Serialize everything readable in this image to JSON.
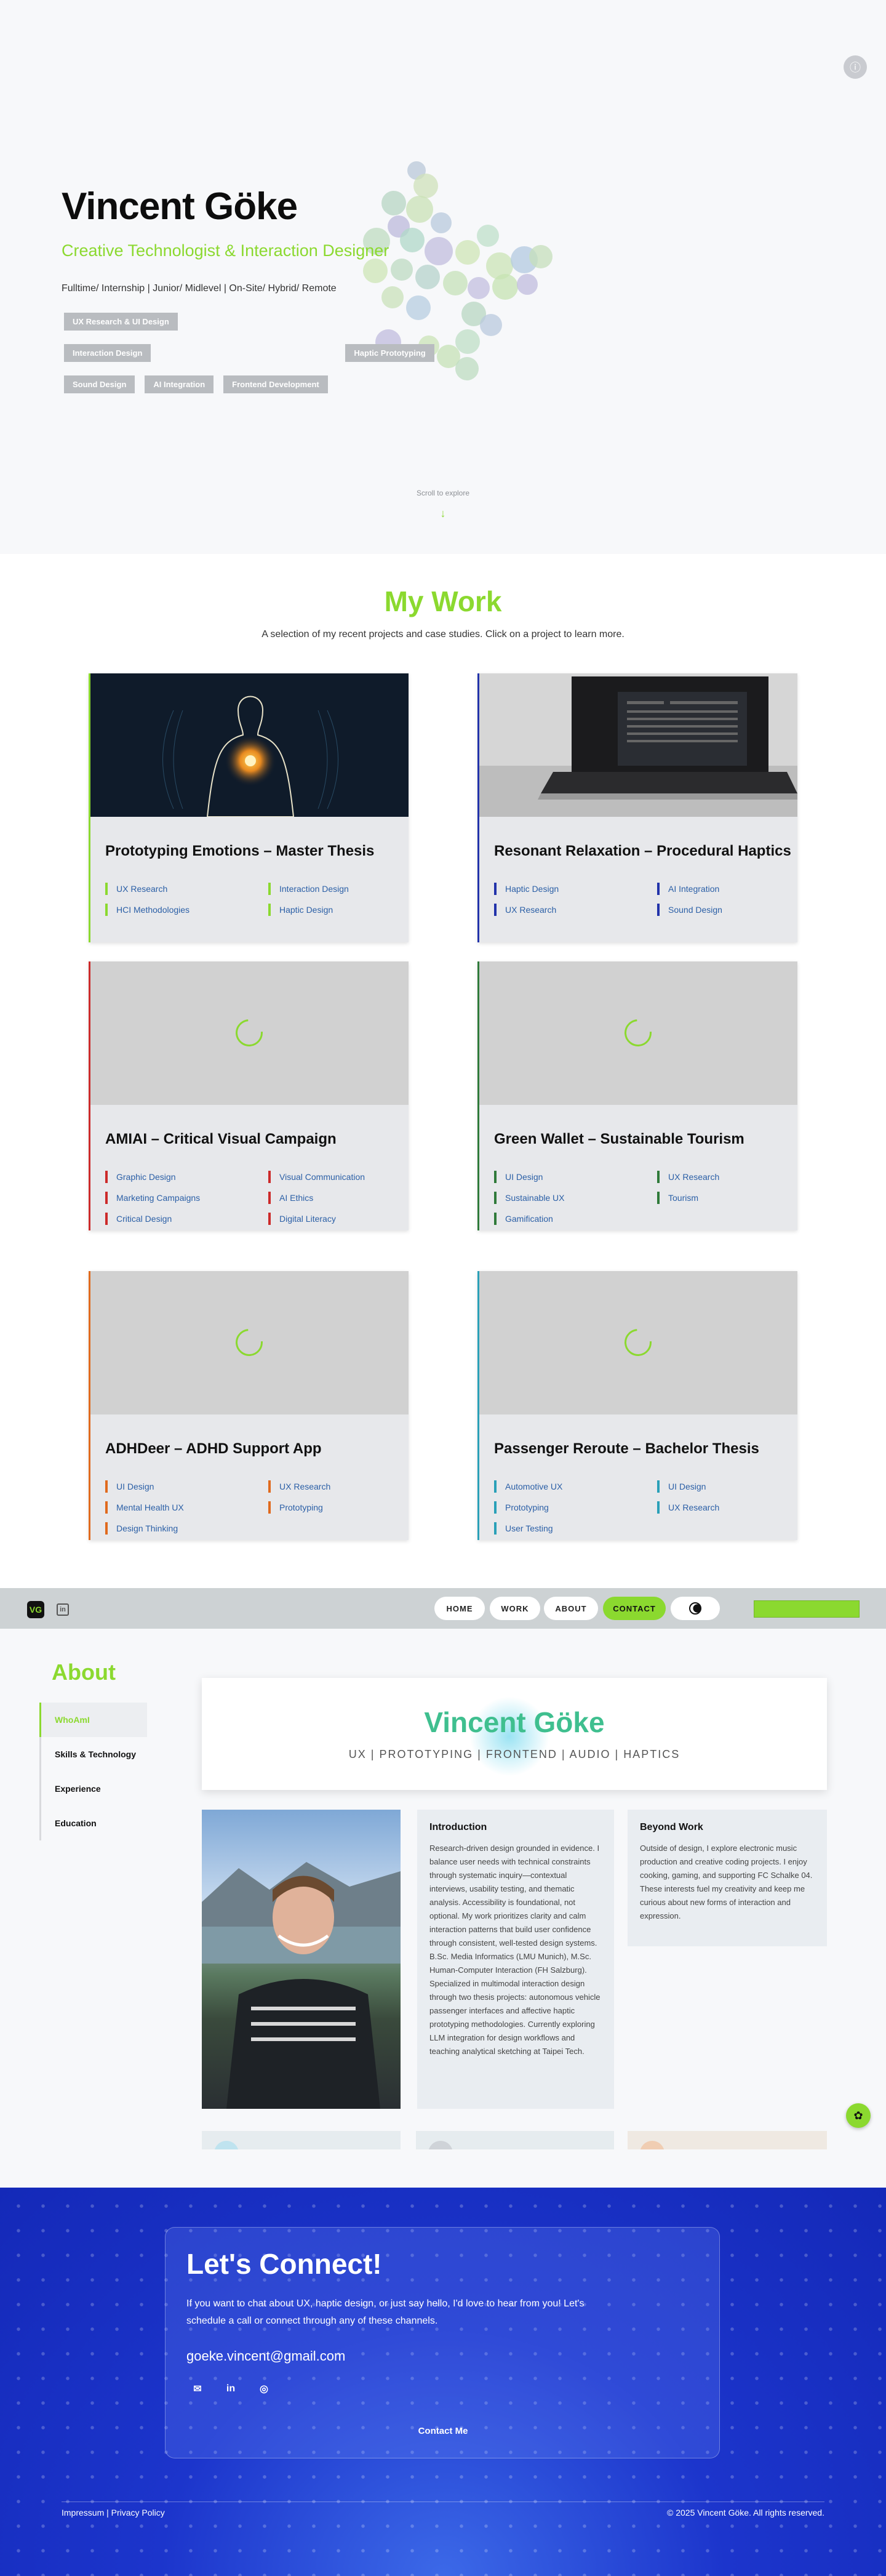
{
  "hero": {
    "name": "Vincent Göke",
    "subtitle": "Creative Technologist & Interaction Designer",
    "availability": "Fulltime/ Internship | Junior/ Midlevel | On-Site/ Hybrid/ Remote",
    "tags": [
      "UX Research & UI Design",
      "Interaction Design",
      "Haptic Prototyping",
      "Sound Design",
      "AI Integration",
      "Frontend Development"
    ],
    "scroll_label": "Scroll to explore",
    "scroll_arrow": "↓",
    "top_icon": "info-icon"
  },
  "work": {
    "title": "My Work",
    "subtitle": "A selection of my recent projects and case studies. Click on a project to learn more.",
    "projects": [
      {
        "title": "Prototyping Emotions – Master Thesis",
        "color": "#8bd92f",
        "tags": [
          "UX Research",
          "Interaction Design",
          "HCI Methodologies",
          "Haptic Design"
        ]
      },
      {
        "title": "Resonant Relaxation – Procedural Haptics",
        "color": "#2233aa",
        "tags": [
          "Haptic Design",
          "AI Integration",
          "UX Research",
          "Sound Design"
        ]
      },
      {
        "title": "AMIAI – Critical Visual Campaign",
        "color": "#cc2a2a",
        "tags": [
          "Graphic Design",
          "Visual Communication",
          "Marketing Campaigns",
          "AI Ethics",
          "Critical Design",
          "Digital Literacy"
        ]
      },
      {
        "title": "Green Wallet – Sustainable Tourism",
        "color": "#2f7a3a",
        "tags": [
          "UI Design",
          "UX Research",
          "Sustainable UX",
          "Tourism",
          "Gamification"
        ]
      },
      {
        "title": "ADHDeer – ADHD Support App",
        "color": "#e06a1e",
        "tags": [
          "UI Design",
          "UX Research",
          "Mental Health UX",
          "Prototyping",
          "Design Thinking"
        ]
      },
      {
        "title": "Passenger Reroute – Bachelor Thesis",
        "color": "#2aa0b8",
        "tags": [
          "Automotive UX",
          "UI Design",
          "Prototyping",
          "UX Research",
          "User Testing"
        ]
      }
    ]
  },
  "nav": {
    "logo": "VG",
    "linkedin": "in",
    "items": [
      "HOME",
      "WORK",
      "ABOUT",
      "CONTACT"
    ],
    "active": "CONTACT",
    "theme_icon": "contrast-icon"
  },
  "about": {
    "title": "About",
    "side_items": [
      "WhoAmI",
      "Skills & Technology",
      "Experience",
      "Education"
    ],
    "name": "Vincent Göke",
    "roles": "UX | PROTOTYPING | FRONTEND | AUDIO | HAPTICS",
    "intro_title": "Introduction",
    "intro_text": "Research-driven design grounded in evidence. I balance user needs with technical constraints through systematic inquiry—contextual interviews, usability testing, and thematic analysis. Accessibility is foundational, not optional. My work prioritizes clarity and calm interaction patterns that build user confidence through consistent, well-tested design systems. B.Sc. Media Informatics (LMU Munich), M.Sc. Human-Computer Interaction (FH Salzburg). Specialized in multimodal interaction design through two thesis projects: autonomous vehicle passenger interfaces and affective haptic prototyping methodologies. Currently exploring LLM integration for design workflows and teaching analytical sketching at Taipei Tech.",
    "beyond_title": "Beyond Work",
    "beyond_text": "Outside of design, I explore electronic music production and creative coding projects. I enjoy cooking, gaming, and supporting FC Schalke 04. These interests fuel my creativity and keep me curious about new forms of interaction and expression."
  },
  "connect": {
    "title": "Let's Connect!",
    "text": "If you want to chat about UX, haptic design, or just say hello, I'd love to hear from you! Let's schedule a call or connect through any of these channels.",
    "email": "goeke.vincent@gmail.com",
    "icons": [
      "mail-icon",
      "linkedin-icon",
      "github-icon"
    ],
    "button": "Contact Me",
    "footer_left": "Impressum | Privacy Policy",
    "footer_right": "© 2025 Vincent Göke. All rights reserved."
  }
}
